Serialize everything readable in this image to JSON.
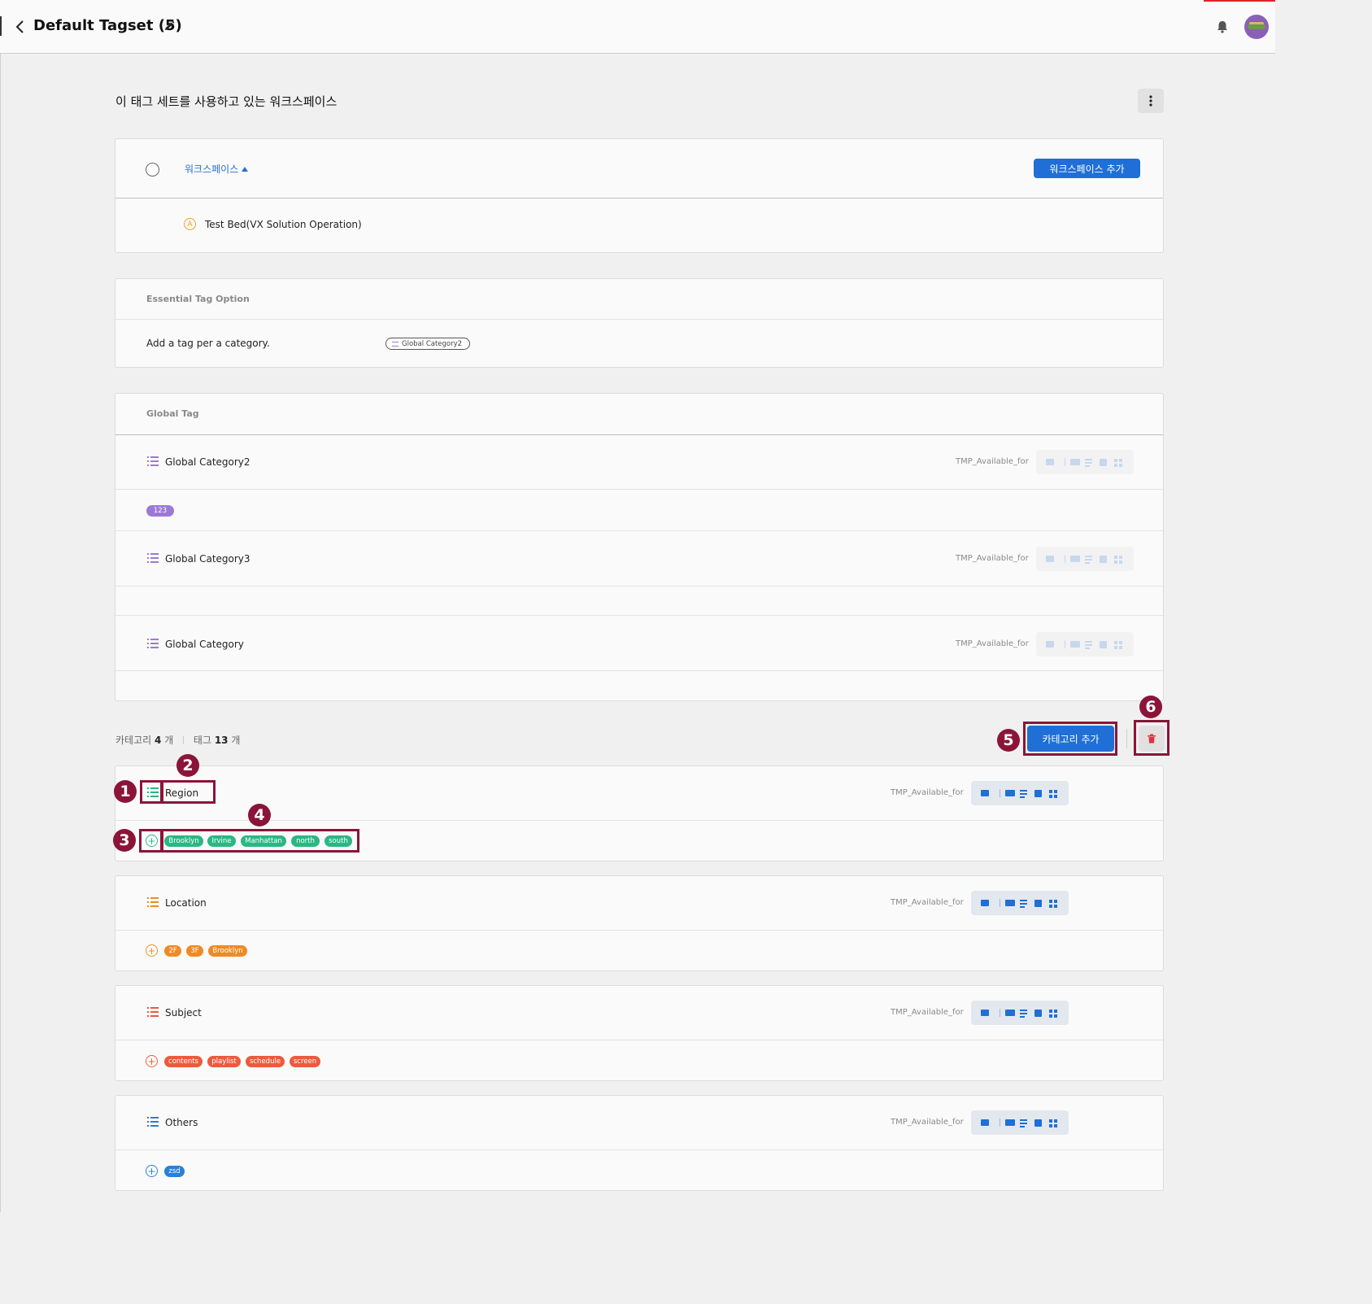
{
  "header": {
    "title": "Default Tagset (5)"
  },
  "workspace_section": {
    "title": "이 태그 세트를 사용하고 있는 워크스페이스",
    "sort_label": "워크스페이스",
    "add_button": "워크스페이스 추가",
    "item_badge": "A",
    "items": [
      "Test Bed(VX Solution Operation)"
    ]
  },
  "essential": {
    "heading": "Essential Tag Option",
    "description": "Add a tag per a category.",
    "chip": "Global Category2"
  },
  "global_tag": {
    "heading": "Global Tag",
    "categories": [
      {
        "name": "Global Category2",
        "permission_label": "TMP_Available_for",
        "tags": [
          "123"
        ]
      },
      {
        "name": "Global Category3",
        "permission_label": "TMP_Available_for",
        "tags": []
      },
      {
        "name": "Global Category",
        "permission_label": "TMP_Available_for",
        "tags": []
      }
    ]
  },
  "summary": {
    "category_label": "카테고리",
    "category_count": "4",
    "category_unit": "개",
    "tag_label": "태그",
    "tag_count": "13",
    "tag_unit": "개",
    "add_category_button": "카테고리 추가"
  },
  "categories": [
    {
      "name": "Region",
      "permission_label": "TMP_Available_for",
      "color": "#2bb784",
      "tags": [
        "Brooklyn",
        "Irvine",
        "Manhattan",
        "north",
        "south"
      ]
    },
    {
      "name": "Location",
      "permission_label": "TMP_Available_for",
      "color": "#f08a24",
      "tags": [
        "2F",
        "3F",
        "Brooklyn"
      ]
    },
    {
      "name": "Subject",
      "permission_label": "TMP_Available_for",
      "color": "#ee5a3c",
      "tags": [
        "contents",
        "playlist",
        "schedule",
        "screen"
      ]
    },
    {
      "name": "Others",
      "permission_label": "TMP_Available_for",
      "color": "#2a7fd8",
      "tags": [
        "zsd"
      ]
    }
  ],
  "annotations": [
    "1",
    "2",
    "3",
    "4",
    "5",
    "6"
  ],
  "colors": {
    "accent": "#1f6fd6",
    "annotation": "#8a1538",
    "global_tag": "#9b7ad6"
  }
}
